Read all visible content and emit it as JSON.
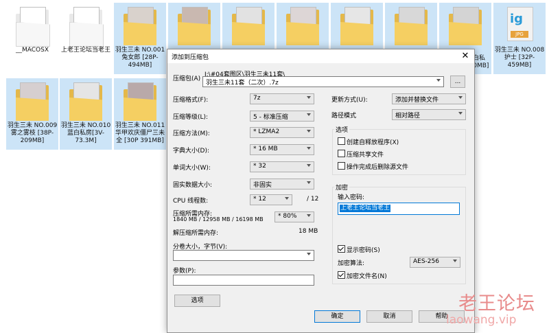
{
  "desktop": {
    "row1": [
      {
        "name": "__MACOSX"
      },
      {
        "name": "上老王论坛当老王"
      },
      {
        "name": "羽生三未 NO.001 兔女郎 [28P-494MB]"
      },
      {
        "name": ""
      },
      {
        "name": ""
      },
      {
        "name": ""
      },
      {
        "name": ""
      },
      {
        "name": ""
      },
      {
        "name": "未白私 [40MB]"
      },
      {
        "name": "羽生三未 NO.008 护士 [32P-459MB]"
      }
    ],
    "row2": [
      {
        "name": "羽生三未 NO.009 雾之雾枝 [38P-209MB]"
      },
      {
        "name": "羽生三未 NO.010 蓝白私房[3V-73.3M]"
      },
      {
        "name": "羽生三未 NO.011 华甲欢庆僵尸三未全 [30P 391MB]"
      }
    ],
    "jpg_label": "JPG",
    "ig_label": "ig"
  },
  "dialog": {
    "title": "添加到压缩包",
    "close_symbol": "✕",
    "archive_label": "压缩包(A)",
    "archive_path": "I:\\#04套图区\\羽生三未11套\\",
    "archive_name": "羽生三未11套（二次）.7z",
    "browse_label": "...",
    "format_label": "压缩格式(F):",
    "format_value": "7z",
    "level_label": "压缩等级(L):",
    "level_value": "5 - 标准压缩",
    "method_label": "压缩方法(M):",
    "method_value": "* LZMA2",
    "dict_label": "字典大小(D):",
    "dict_value": "* 16 MB",
    "word_label": "单词大小(W):",
    "word_value": "* 32",
    "solid_label": "固实数据大小:",
    "solid_value": "非固实",
    "cpu_label": "CPU 线程数:",
    "cpu_value": "* 12",
    "cpu_total": "/ 12",
    "mem_label": "压缩所需内存:",
    "mem_value": "1840 MB / 12958 MB / 16198 MB",
    "mem_percent": "* 80%",
    "decomp_label": "解压缩所需内存:",
    "decomp_value": "18 MB",
    "split_label": "分卷大小，字节(V):",
    "split_value": "",
    "params_label": "参数(P):",
    "params_value": "",
    "options_button": "选项",
    "update_label": "更新方式(U):",
    "update_value": "添加并替换文件",
    "path_label": "路径模式",
    "path_value": "相对路径",
    "options_group": "选项",
    "opt_sfx": "创建自释放程序(X)",
    "opt_shared": "压缩共享文件",
    "opt_delete": "操作完成后删除源文件",
    "encrypt_group": "加密",
    "password_label": "输入密码:",
    "password_value": "上老王论坛当老王",
    "show_password": "显示密码(S)",
    "encrypt_method_label": "加密算法:",
    "encrypt_method_value": "AES-256",
    "encrypt_names": "加密文件名(N)",
    "ok_button": "确定",
    "cancel_button": "取消",
    "help_button": "帮助"
  },
  "watermark": {
    "cn": "老王论坛",
    "en": "laowang.vip"
  }
}
